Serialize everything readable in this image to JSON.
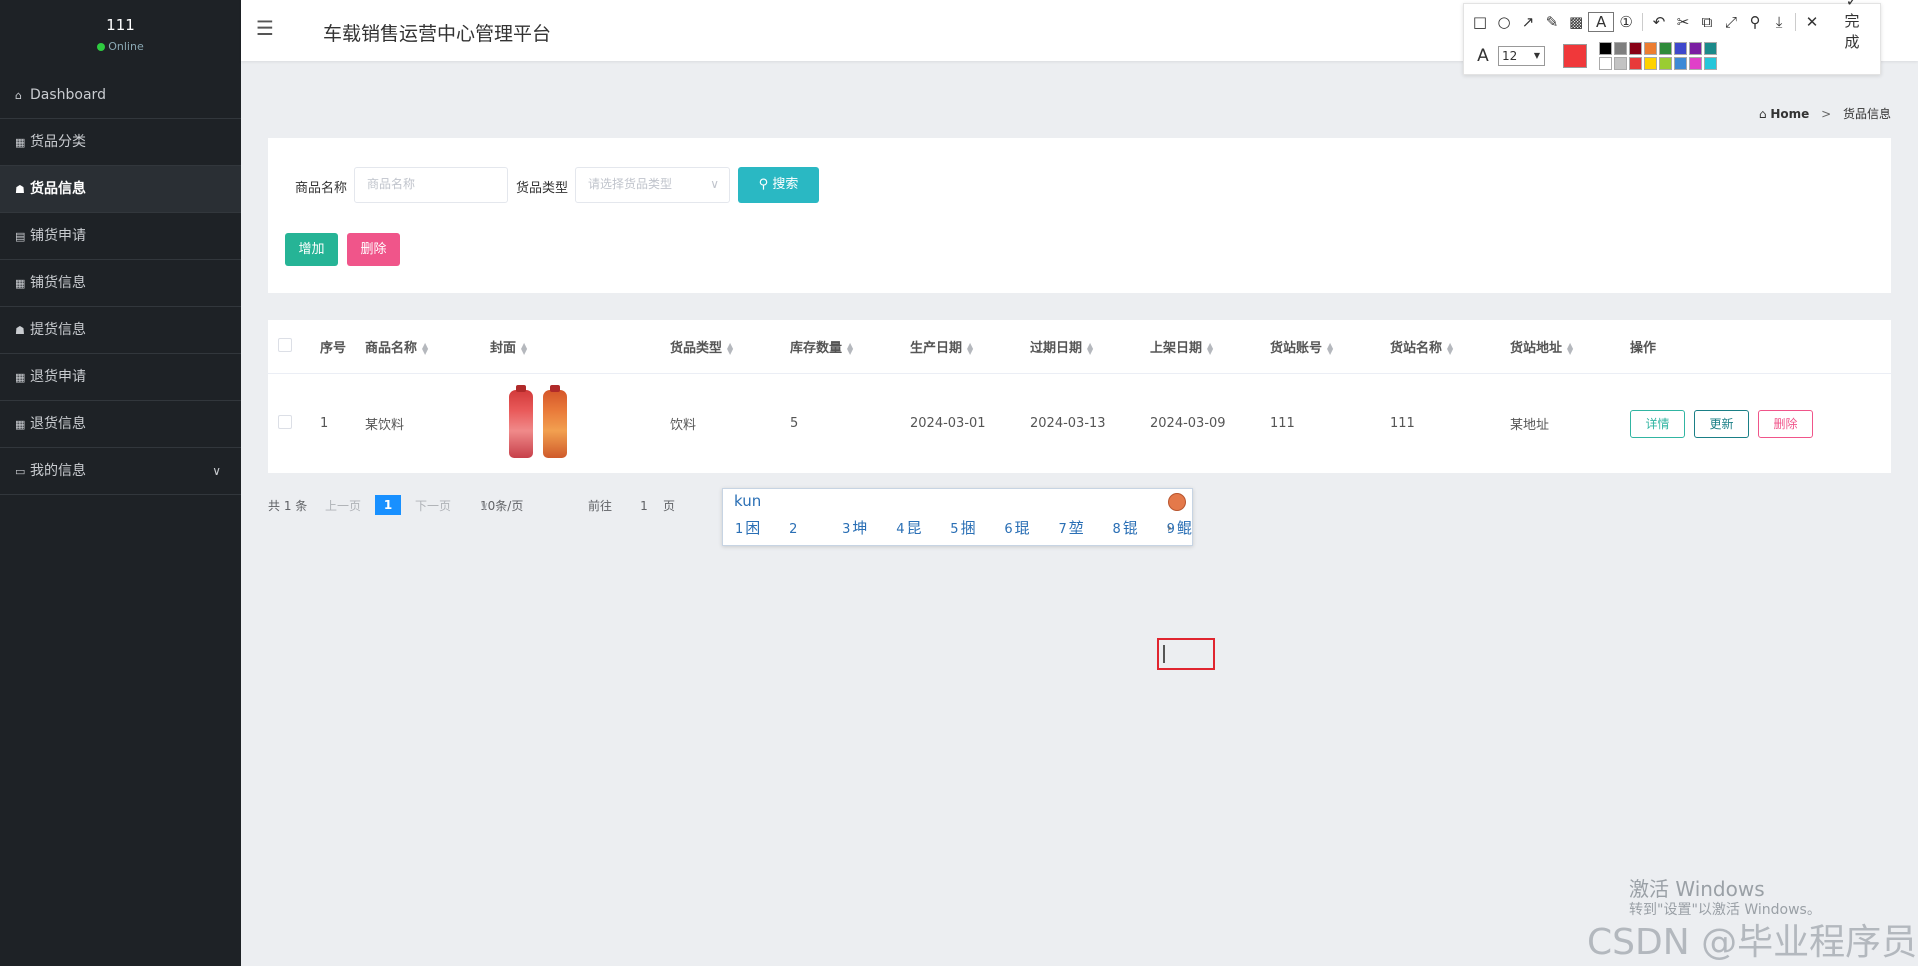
{
  "sidebar": {
    "user_name": "111",
    "status": "Online",
    "items": [
      {
        "icon": "⌂",
        "label": "Dashboard"
      },
      {
        "icon": "▦",
        "label": "货品分类"
      },
      {
        "icon": "☗",
        "label": "货品信息"
      },
      {
        "icon": "▤",
        "label": "铺货申请"
      },
      {
        "icon": "▦",
        "label": "铺货信息"
      },
      {
        "icon": "☗",
        "label": "提货信息"
      },
      {
        "icon": "▦",
        "label": "退货申请"
      },
      {
        "icon": "▦",
        "label": "退货信息"
      },
      {
        "icon": "▭",
        "label": "我的信息"
      }
    ]
  },
  "header": {
    "title": "车载销售运营中心管理平台"
  },
  "snip_toolbar": {
    "font_size": "12",
    "done_label": "完成",
    "current_color": "#f0383a",
    "palette": [
      "#000000",
      "#7f7f7f",
      "#880015",
      "#ed7d31",
      "#2e8b3a",
      "#3f48cc",
      "#7b1fa2",
      "#1b8a8a",
      "#ffffff",
      "#c3c3c3",
      "#e83a3a",
      "#ffd200",
      "#9acd32",
      "#3d8ad6",
      "#e040c8",
      "#26c6da"
    ]
  },
  "breadcrumb": {
    "home": "Home",
    "sep": ">",
    "current": "货品信息"
  },
  "search": {
    "name_label": "商品名称",
    "name_placeholder": "商品名称",
    "type_label": "货品类型",
    "type_placeholder": "请选择货品类型",
    "search_button": "搜索",
    "add_button": "增加",
    "delete_button": "删除"
  },
  "table": {
    "columns": [
      "序号",
      "商品名称",
      "封面",
      "货品类型",
      "库存数量",
      "生产日期",
      "过期日期",
      "上架日期",
      "货站账号",
      "货站名称",
      "货站地址",
      "操作"
    ],
    "rows": [
      {
        "index": "1",
        "name": "某饮料",
        "type": "饮料",
        "stock": "5",
        "production_date": "2024-03-01",
        "expiry_date": "2024-03-13",
        "shelf_date": "2024-03-09",
        "station_account": "111",
        "station_name": "111",
        "station_address": "某地址",
        "actions": {
          "detail": "详情",
          "update": "更新",
          "delete": "删除"
        }
      }
    ]
  },
  "pagination": {
    "total": "共 1 条",
    "prev": "上一页",
    "current_page": "1",
    "next": "下一页",
    "page_size": "10条/页",
    "goto_label": "前往",
    "goto_value": "1",
    "goto_suffix": "页"
  },
  "ime": {
    "input": "kun",
    "candidates": [
      {
        "n": "1",
        "text": "困"
      },
      {
        "n": "2",
        "text": ""
      },
      {
        "n": "3",
        "text": "坤"
      },
      {
        "n": "4",
        "text": "昆"
      },
      {
        "n": "5",
        "text": "捆"
      },
      {
        "n": "6",
        "text": "琨"
      },
      {
        "n": "7",
        "text": "堃"
      },
      {
        "n": "8",
        "text": "锟"
      },
      {
        "n": "9",
        "text": "鲲"
      }
    ],
    "next_symbol": "›"
  },
  "watermarks": {
    "windows_line1": "激活 Windows",
    "windows_line2": "转到\"设置\"以激活 Windows。",
    "csdn": "CSDN @毕业程序员"
  }
}
